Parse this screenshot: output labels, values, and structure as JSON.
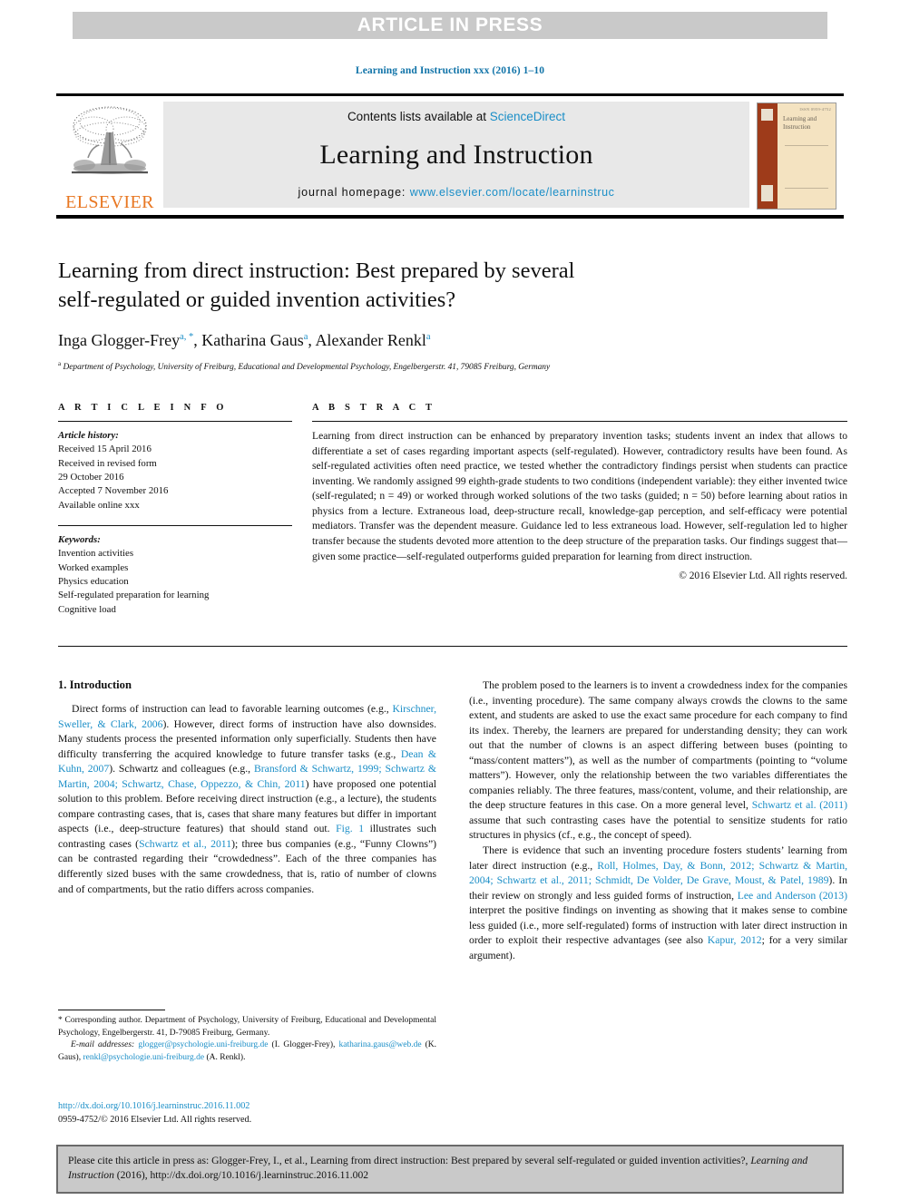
{
  "banner": {
    "text": "ARTICLE IN PRESS"
  },
  "running_head": {
    "text": "Learning and Instruction xxx (2016) 1–10"
  },
  "masthead": {
    "contents_prefix": "Contents lists available at ",
    "sciencedirect": "ScienceDirect",
    "journal_title": "Learning and Instruction",
    "homepage_prefix": "journal homepage: ",
    "homepage_url": "www.elsevier.com/locate/learninstruc",
    "publisher_logo_text": "ELSEVIER",
    "cover": {
      "title_line1": "Learning and",
      "title_line2": "Instruction",
      "corner_text": "ISSN 0959-4752"
    },
    "link_color": "#1a8ec7"
  },
  "article": {
    "title_line1": "Learning from direct instruction: Best prepared by several",
    "title_line2": "self-regulated or guided invention activities?",
    "authors_html": "Inga Glogger-Frey, Katharina Gaus, Alexander Renkl",
    "author_list": [
      {
        "name": "Inga Glogger-Frey",
        "marks": "a, *"
      },
      {
        "name": "Katharina Gaus",
        "marks": "a"
      },
      {
        "name": "Alexander Renkl",
        "marks": "a"
      }
    ],
    "affiliation_mark": "a",
    "affiliation": "Department of Psychology, University of Freiburg, Educational and Developmental Psychology, Engelbergerstr. 41, 79085 Freiburg, Germany"
  },
  "article_info": {
    "heading": "A R T I C L E   I N F O",
    "history_label": "Article history:",
    "history": [
      "Received 15 April 2016",
      "Received in revised form",
      "29 October 2016",
      "Accepted 7 November 2016",
      "Available online xxx"
    ],
    "keywords_label": "Keywords:",
    "keywords": [
      "Invention activities",
      "Worked examples",
      "Physics education",
      "Self-regulated preparation for learning",
      "Cognitive load"
    ]
  },
  "abstract": {
    "heading": "A B S T R A C T",
    "text": "Learning from direct instruction can be enhanced by preparatory invention tasks; students invent an index that allows to differentiate a set of cases regarding important aspects (self-regulated). However, contradictory results have been found. As self-regulated activities often need practice, we tested whether the contradictory findings persist when students can practice inventing. We randomly assigned 99 eighth-grade students to two conditions (independent variable): they either invented twice (self-regulated; n = 49) or worked through worked solutions of the two tasks (guided; n = 50) before learning about ratios in physics from a lecture. Extraneous load, deep-structure recall, knowledge-gap perception, and self-efficacy were potential mediators. Transfer was the dependent measure. Guidance led to less extraneous load. However, self-regulation led to higher transfer because the students devoted more attention to the deep structure of the preparation tasks. Our findings suggest that—given some practice—self-regulated outperforms guided preparation for learning from direct instruction.",
    "copyright": "© 2016 Elsevier Ltd. All rights reserved."
  },
  "section": {
    "heading": "1. Introduction"
  },
  "body": {
    "left_paragraphs": [
      {
        "parts": [
          {
            "t": "Direct forms of instruction can lead to favorable learning outcomes (e.g., ",
            "r": false
          },
          {
            "t": "Kirschner, Sweller, & Clark, 2006",
            "r": true
          },
          {
            "t": "). However, direct forms of instruction have also downsides. Many students process the presented information only superficially. Students then have difficulty transferring the acquired knowledge to future transfer tasks (e.g., ",
            "r": false
          },
          {
            "t": "Dean & Kuhn, 2007",
            "r": true
          },
          {
            "t": "). Schwartz and colleagues (e.g., ",
            "r": false
          },
          {
            "t": "Bransford & Schwartz, 1999; Schwartz & Martin, 2004; Schwartz, Chase, Oppezzo, & Chin, 2011",
            "r": true
          },
          {
            "t": ") have proposed one potential solution to this problem. Before receiving direct instruction (e.g., a lecture), the students compare contrasting cases, that is, cases that share many features but differ in important aspects (i.e., deep-structure features) that should stand out. ",
            "r": false
          },
          {
            "t": "Fig. 1",
            "r": true
          },
          {
            "t": " illustrates such contrasting cases (",
            "r": false
          },
          {
            "t": "Schwartz et al., 2011",
            "r": true
          },
          {
            "t": "); three bus companies (e.g., “Funny Clowns”) can be contrasted regarding their “crowdedness”. Each of the three companies has differently sized buses with the same crowdedness, that is, ratio of number of clowns and of compartments, but the ratio differs across companies.",
            "r": false
          }
        ]
      }
    ],
    "right_paragraphs": [
      {
        "parts": [
          {
            "t": "The problem posed to the learners is to invent a crowdedness index for the companies (i.e., inventing procedure). The same company always crowds the clowns to the same extent, and students are asked to use the exact same procedure for each company to find its index. Thereby, the learners are prepared for understanding density; they can work out that the number of clowns is an aspect differing between buses (pointing to “mass/content matters”), as well as the number of compartments (pointing to “volume matters”). However, only the relationship between the two variables differentiates the companies reliably. The three features, mass/content, volume, and their relationship, are the deep structure features in this case. On a more general level, ",
            "r": false
          },
          {
            "t": "Schwartz et al. (2011)",
            "r": true
          },
          {
            "t": " assume that such contrasting cases have the potential to sensitize students for ratio structures in physics (cf., e.g., the concept of speed).",
            "r": false
          }
        ]
      },
      {
        "parts": [
          {
            "t": "There is evidence that such an inventing procedure fosters students’ learning from later direct instruction (e.g., ",
            "r": false
          },
          {
            "t": "Roll, Holmes, Day, & Bonn, 2012; Schwartz & Martin, 2004; Schwartz et al., 2011; Schmidt, De Volder, De Grave, Moust, & Patel, 1989",
            "r": true
          },
          {
            "t": "). In their review on strongly and less guided forms of instruction, ",
            "r": false
          },
          {
            "t": "Lee and Anderson (2013)",
            "r": true
          },
          {
            "t": " interpret the positive findings on inventing as showing that it makes sense to combine less guided (i.e., more self-regulated) forms of instruction with later direct instruction in order to exploit their respective advantages (see also ",
            "r": false
          },
          {
            "t": "Kapur, 2012",
            "r": true
          },
          {
            "t": "; for a very similar argument).",
            "r": false
          }
        ]
      }
    ]
  },
  "footnote": {
    "corresponding_mark": "*",
    "corresponding": "Corresponding author. Department of Psychology, University of Freiburg, Educational and Developmental Psychology, Engelbergerstr. 41, D-79085 Freiburg, Germany.",
    "email_label": "E-mail addresses:",
    "emails": [
      {
        "address": "glogger@psychologie.uni-freiburg.de",
        "owner": "(I. Glogger-Frey)"
      },
      {
        "address": "katharina.gaus@web.de",
        "owner": "(K. Gaus)"
      },
      {
        "address": "renkl@psychologie.uni-freiburg.de",
        "owner": "(A. Renkl)"
      }
    ]
  },
  "doi_block": {
    "doi_url": "http://dx.doi.org/10.1016/j.learninstruc.2016.11.002",
    "issn_line": "0959-4752/© 2016 Elsevier Ltd. All rights reserved."
  },
  "cite_box": {
    "prefix": "Please cite this article in press as: Glogger-Frey, I., et al., Learning from direct instruction: Best prepared by several self-regulated or guided invention activities?, ",
    "journal": "Learning and Instruction",
    "suffix": " (2016), http://dx.doi.org/10.1016/j.learninstruc.2016.11.002"
  }
}
